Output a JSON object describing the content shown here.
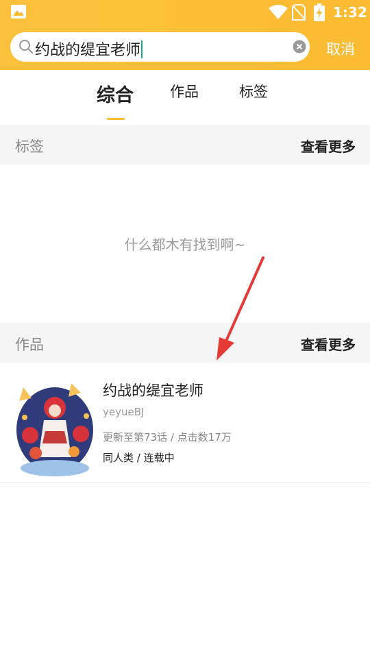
{
  "status_bar": {
    "time": "1:32"
  },
  "search": {
    "query": "约战的缇宜老师",
    "cancel_label": "取消"
  },
  "tabs": [
    {
      "label": "综合",
      "active": true
    },
    {
      "label": "作品",
      "active": false
    },
    {
      "label": "标签",
      "active": false
    }
  ],
  "tags_section": {
    "title": "标签",
    "more_label": "查看更多",
    "empty_text": "什么都木有找到啊~"
  },
  "works_section": {
    "title": "作品",
    "more_label": "查看更多",
    "items": [
      {
        "title": "约战的缇宜老师",
        "author": "yeyueBJ",
        "update": "更新至第73话 / 点击数17万",
        "genre": "同人类 / 连载中"
      }
    ]
  },
  "colors": {
    "accent": "#fcbc33",
    "annotation_arrow": "#e53935"
  }
}
